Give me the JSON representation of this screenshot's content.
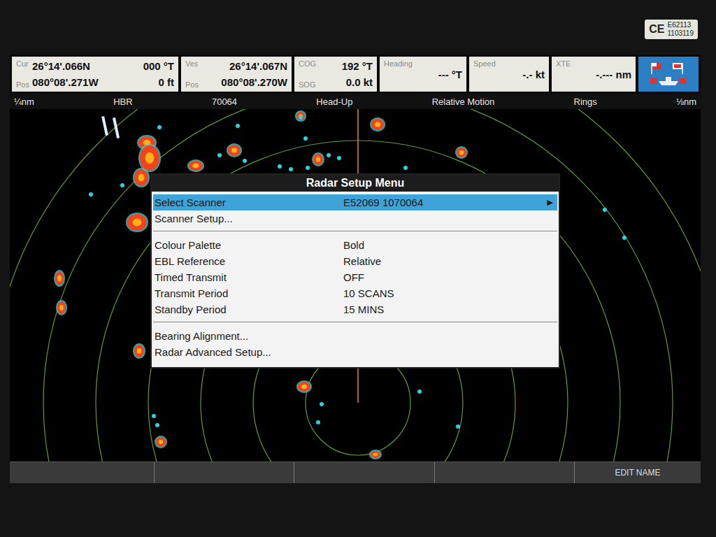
{
  "sticker": {
    "mark": "CE",
    "lines": [
      "E62113",
      "1103119"
    ]
  },
  "databar": [
    {
      "labels": [
        "Cur",
        "Pos"
      ],
      "lines": [
        [
          "26°14'.066N",
          "000 °T"
        ],
        [
          "080°08'.271W",
          "0 ft"
        ]
      ]
    },
    {
      "labels": [
        "Ves",
        "Pos"
      ],
      "lines": [
        [
          "26°14'.067N"
        ],
        [
          "080°08'.270W"
        ]
      ]
    },
    {
      "labels": [
        "COG",
        "SOG"
      ],
      "lines": [
        [
          "192 °T"
        ],
        [
          "0.0 kt"
        ]
      ]
    },
    {
      "labels": [
        "Heading"
      ],
      "lines": [
        [
          "--- °T"
        ]
      ]
    },
    {
      "labels": [
        "Speed"
      ],
      "lines": [
        [
          "-.- kt"
        ]
      ]
    },
    {
      "labels": [
        "XTE"
      ],
      "lines": [
        [
          "-.--- nm"
        ]
      ]
    }
  ],
  "status_bar": [
    "¼nm",
    "HBR",
    "70064",
    "Head-Up",
    "Relative Motion",
    "Rings",
    "⅛nm"
  ],
  "menu": {
    "title": "Radar Setup Menu",
    "groups": [
      [
        {
          "label": "Select Scanner",
          "value": "E52069 1070064",
          "arrow": "▶",
          "selected": true
        },
        {
          "label": "Scanner Setup...",
          "value": "",
          "arrow": "",
          "selected": false
        }
      ],
      [
        {
          "label": "Colour Palette",
          "value": "Bold",
          "arrow": "",
          "selected": false
        },
        {
          "label": "EBL Reference",
          "value": "Relative",
          "arrow": "",
          "selected": false
        },
        {
          "label": "Timed Transmit",
          "value": "OFF",
          "arrow": "",
          "selected": false
        },
        {
          "label": "Transmit Period",
          "value": "10 SCANS",
          "arrow": "",
          "selected": false
        },
        {
          "label": "Standby Period",
          "value": "15 MINS",
          "arrow": "",
          "selected": false
        }
      ],
      [
        {
          "label": "Bearing Alignment...",
          "value": "",
          "arrow": "",
          "selected": false
        },
        {
          "label": "Radar Advanced Setup...",
          "value": "",
          "arrow": "",
          "selected": false
        }
      ]
    ]
  },
  "softkeys": [
    "",
    "",
    "",
    "",
    "EDIT NAME"
  ]
}
